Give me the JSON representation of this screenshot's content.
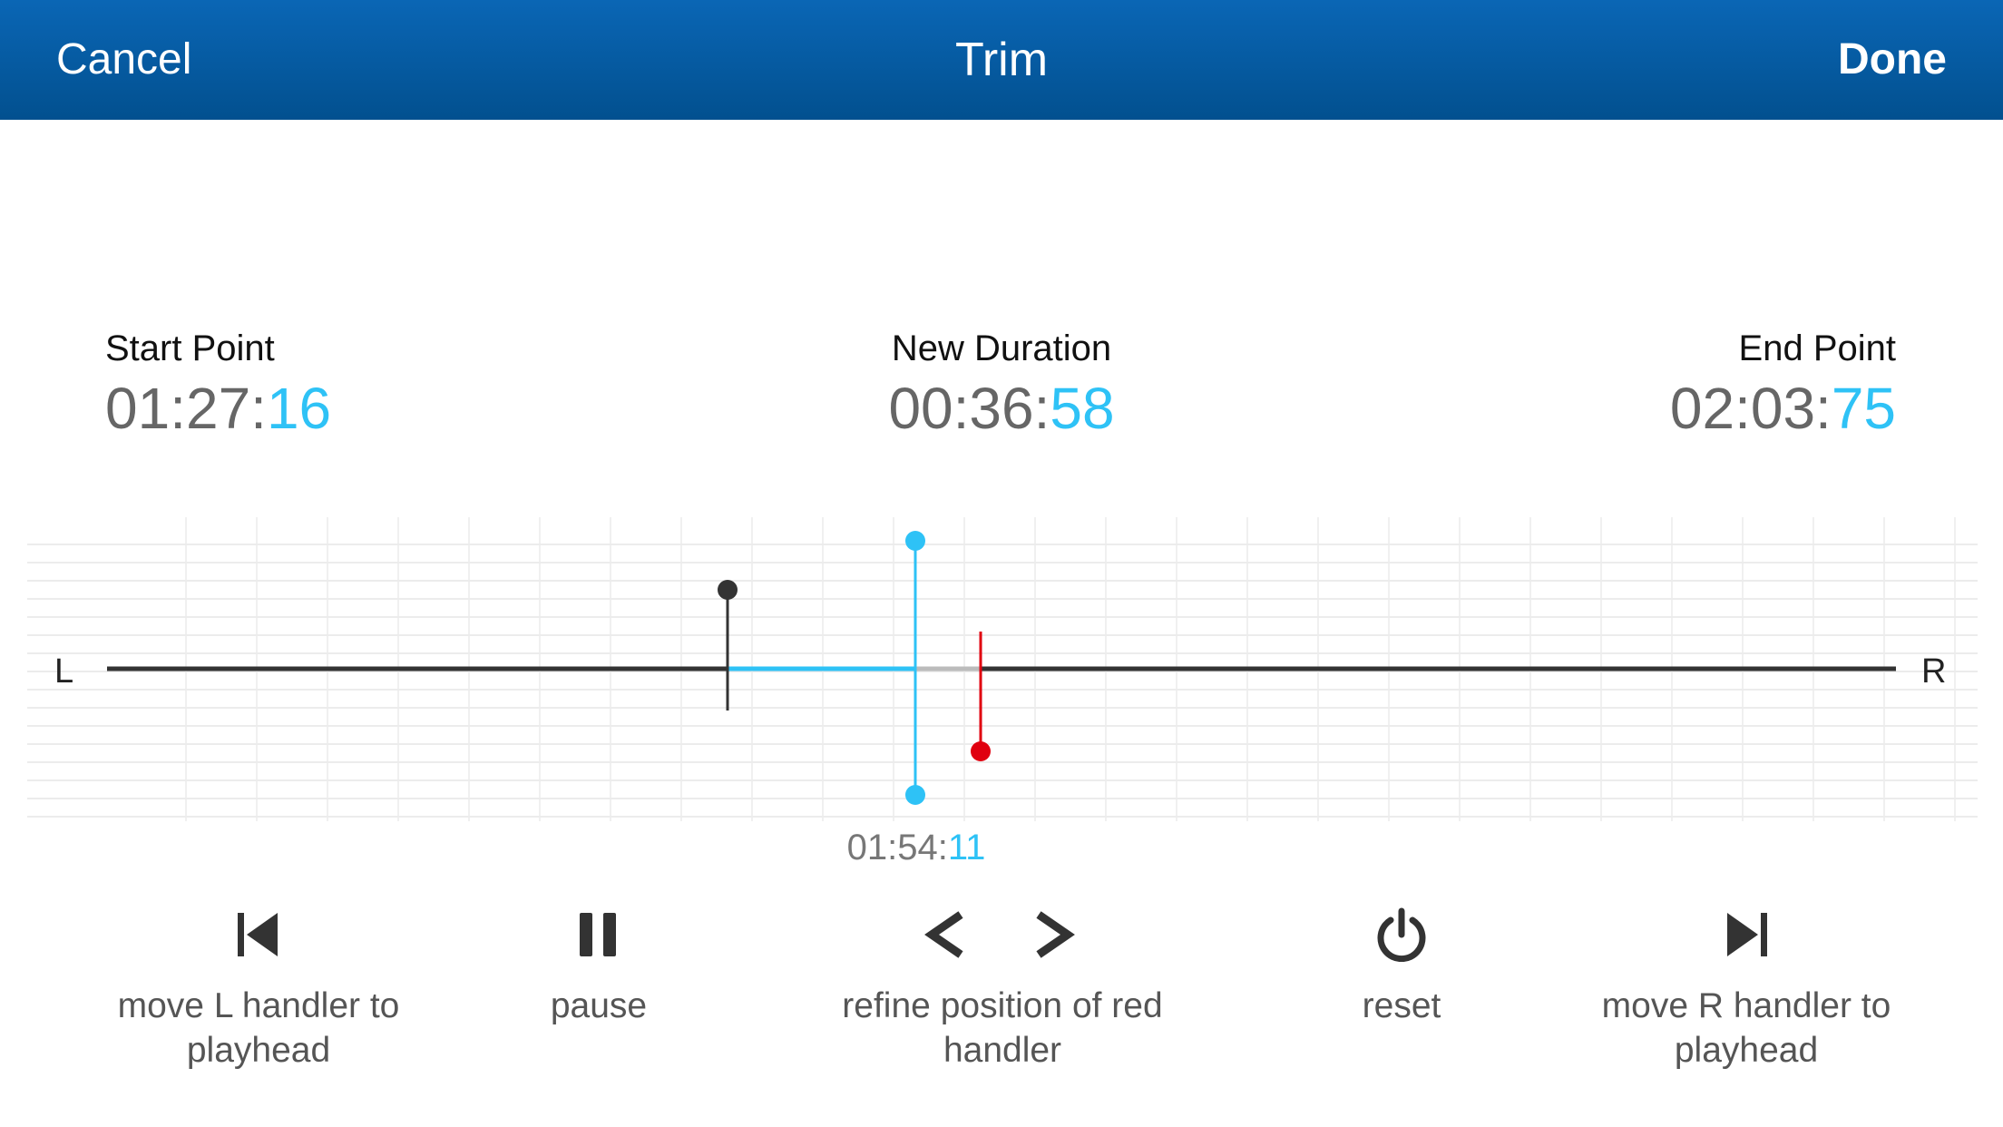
{
  "nav": {
    "cancel": "Cancel",
    "title": "Trim",
    "done": "Done"
  },
  "start": {
    "label": "Start Point",
    "main": "01:27:",
    "frac": "16"
  },
  "duration": {
    "label": "New Duration",
    "main": "00:36:",
    "frac": "58"
  },
  "end": {
    "label": "End Point",
    "main": "02:03:",
    "frac": "75"
  },
  "track": {
    "left_label": "L",
    "right_label": "R"
  },
  "playhead": {
    "main": "01:54:",
    "frac": "11"
  },
  "controls": {
    "move_l": "move L handler to playhead",
    "pause": "pause",
    "refine": "refine position of red handler",
    "reset": "reset",
    "move_r": "move R handler to playhead"
  },
  "icons": {
    "move_l": "skip-back-icon",
    "pause": "pause-icon",
    "refine_left": "chevron-left-icon",
    "refine_right": "chevron-right-icon",
    "reset": "power-icon",
    "move_r": "skip-forward-icon"
  },
  "colors": {
    "nav": "#0a66b5",
    "accent": "#2ec2f6",
    "red": "#e0000f",
    "dark": "#333333"
  }
}
